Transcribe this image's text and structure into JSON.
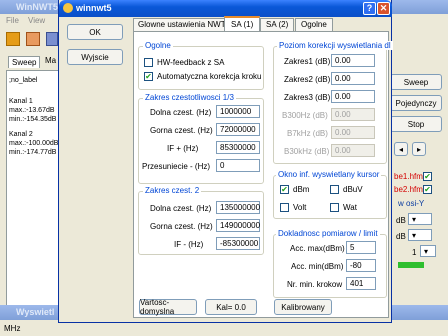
{
  "bg": {
    "title": "WinNWT5",
    "menu": [
      "File",
      "View"
    ],
    "tabs": [
      "Sweep",
      "Ma"
    ],
    "log_lines": [
      ";no_label",
      "Kanal 1",
      "max.:-13.67dB",
      "min.:-154.35dB",
      "Kanal 2",
      "max.:-100.00dB",
      "min.:-174.77dB"
    ],
    "right_buttons": [
      "Sweep",
      "Pojedynczy",
      "Stop"
    ],
    "right_files": [
      "be1.hfm",
      "be2.hfm"
    ],
    "right_osi": "w osi-Y",
    "right_rows": [
      {
        "val": "dB"
      },
      {
        "val": "dB"
      },
      {
        "val": "1"
      }
    ],
    "bottom_title": "Wyswietl",
    "bottom_status": "MHz"
  },
  "dlg": {
    "title": "winnwt5",
    "ok": "OK",
    "exit": "Wyjscie",
    "tabs": [
      "Glowne ustawienia NWT",
      "SA (1)",
      "SA (2)",
      "Ogolne"
    ],
    "general": {
      "title": "Ogolne",
      "hw_feedback": "HW-feedback z SA",
      "auto_corr": "Automatyczna korekcja kroku"
    },
    "range13": {
      "title": "Zakres czestotliwosci 1/3",
      "rows": [
        {
          "label": "Dolna czest. (Hz)",
          "value": "1000000"
        },
        {
          "label": "Gorna czest. (Hz)",
          "value": "72000000"
        },
        {
          "label": "IF + (Hz)",
          "value": "85300000"
        },
        {
          "label": "Przesuniecie - (Hz)",
          "value": "0"
        }
      ]
    },
    "range2": {
      "title": "Zakres czest. 2",
      "rows": [
        {
          "label": "Dolna czest. (Hz)",
          "value": "135000000"
        },
        {
          "label": "Gorna czest. (Hz)",
          "value": "149000000"
        },
        {
          "label": "IF - (Hz)",
          "value": "-85300000"
        }
      ]
    },
    "correction": {
      "title": "Poziom korekcji wyswietlania dl",
      "rows": [
        {
          "label": "Zakres1 (dB)",
          "value": "0.00",
          "disabled": false
        },
        {
          "label": "Zakres2 (dB)",
          "value": "0.00",
          "disabled": false
        },
        {
          "label": "Zakres3 (dB)",
          "value": "0.00",
          "disabled": false
        },
        {
          "label": "B300Hz (dB)",
          "value": "0.00",
          "disabled": true
        },
        {
          "label": "B7kHz (dB)",
          "value": "0.00",
          "disabled": true
        },
        {
          "label": "B30kHz (dB)",
          "value": "0.00",
          "disabled": true
        }
      ]
    },
    "cursor": {
      "title": "Okno inf. wyswietlany kursor",
      "items": [
        {
          "label": "dBm",
          "checked": true
        },
        {
          "label": "dBuV",
          "checked": false
        },
        {
          "label": "Volt",
          "checked": false
        },
        {
          "label": "Wat",
          "checked": false
        }
      ]
    },
    "accuracy": {
      "title": "Dokladnosc pomiarow / limit",
      "rows": [
        {
          "label": "Acc. max(dBm)",
          "value": "5"
        },
        {
          "label": "Acc. min(dBm)",
          "value": "-80"
        },
        {
          "label": "Nr. min. krokow",
          "value": "401"
        }
      ]
    },
    "bottom_buttons": [
      "Vartosc-domyslna",
      "Kal= 0.0",
      "Kalibrowany"
    ]
  },
  "colors": {
    "title_active": "#0a58d8",
    "accent_red": "#d40000",
    "check_green": "#21a121"
  }
}
